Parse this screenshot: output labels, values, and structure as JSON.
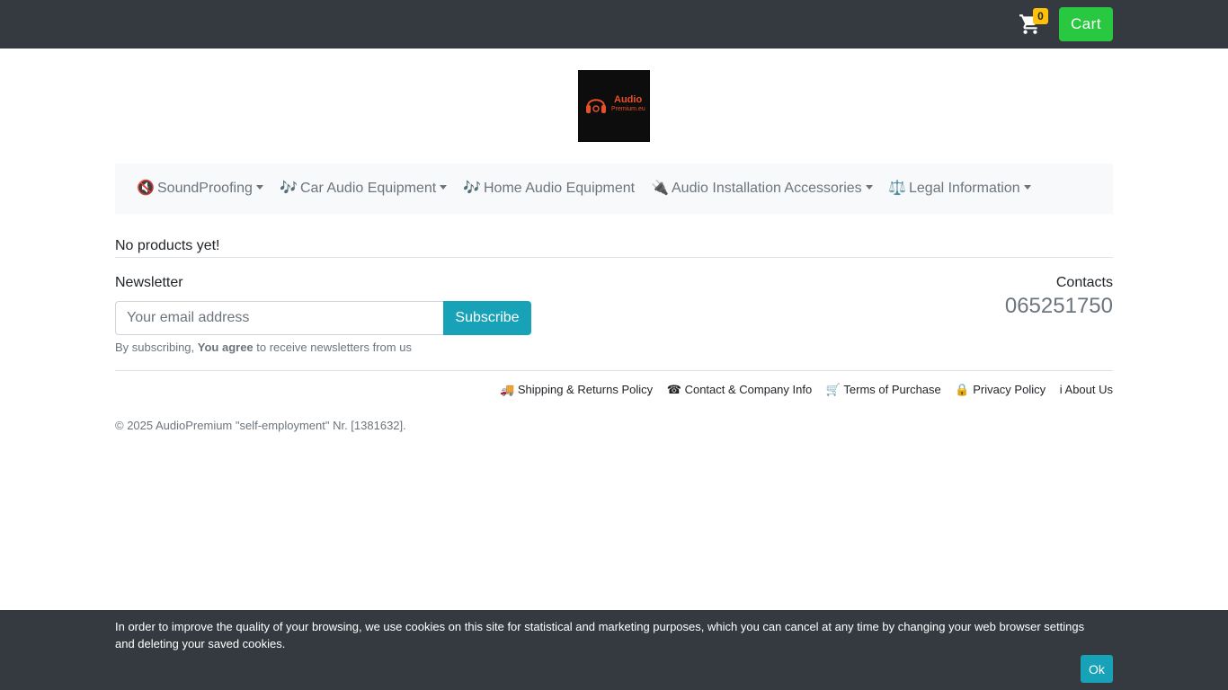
{
  "header": {
    "cart_count": "0",
    "cart_label": "Cart",
    "cart_icon": "shopping-cart-icon"
  },
  "logo": {
    "line1": "Audio",
    "line2": "Premium.eu"
  },
  "nav": {
    "items": [
      {
        "icon": "🔇",
        "label": "SoundProofing",
        "dropdown": true
      },
      {
        "icon": "🎶",
        "label": "Car Audio Equipment",
        "dropdown": true
      },
      {
        "icon": "🎶",
        "label": "Home Audio Equipment",
        "dropdown": false
      },
      {
        "icon": "🔌",
        "label": "Audio Installation Accessories",
        "dropdown": true
      },
      {
        "icon": "⚖️",
        "label": "Legal Information",
        "dropdown": true
      }
    ]
  },
  "main": {
    "empty_message": "No products yet!"
  },
  "newsletter": {
    "title": "Newsletter",
    "placeholder": "Your email address",
    "subscribe_label": "Subscribe",
    "note_prefix": "By subscribing, ",
    "note_bold": "You agree",
    "note_suffix": " to receive newsletters from us"
  },
  "contacts": {
    "title": "Contacts",
    "phone": "065251750"
  },
  "footer": {
    "links": [
      "🚚 Shipping & Returns Policy",
      "☎ Contact & Company Info",
      "🛒 Terms of Purchase",
      "🔒 Privacy Policy",
      "i About Us"
    ],
    "copyright": "© 2025 AudioPremium \"self-employment\" Nr. [1381632]."
  },
  "cookie": {
    "text": "In order to improve the quality of your browsing, we use cookies on this site for statistical and marketing purposes, which you can cancel at any time by changing your web browser settings and deleting your saved cookies.",
    "ok_label": "Ok"
  },
  "colors": {
    "topbar": "#343a40",
    "cart_button": "#28c940",
    "badge": "#ffc107",
    "accent": "#17a2b8",
    "navbar_bg": "#f8f9fa",
    "logo_orange": "#e8502a"
  }
}
